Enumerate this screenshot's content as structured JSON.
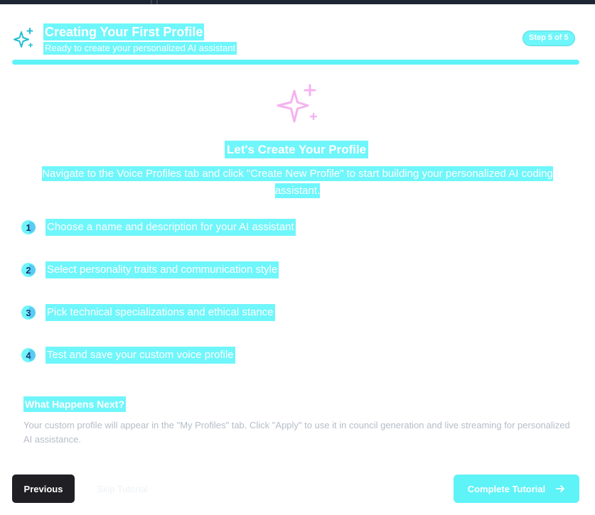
{
  "header": {
    "title": "Creating Your First Profile",
    "subtitle": "Ready to create your personalized AI assistant",
    "step_badge": "Step 5 of 5",
    "progress": 1.0,
    "icon": "sparkles-icon"
  },
  "content": {
    "hero_icon": "sparkles-icon",
    "heading": "Let's Create Your Profile",
    "description_line1": "Navigate to the Voice Profiles tab and click \"Create New Profile\" to start building your personalized AI coding",
    "description_line2": "assistant.",
    "steps": [
      {
        "number": "1",
        "text": "Choose a name and description for your AI assistant"
      },
      {
        "number": "2",
        "text": "Select personality traits and communication style"
      },
      {
        "number": "3",
        "text": "Pick technical specializations and ethical stance"
      },
      {
        "number": "4",
        "text": "Test and save your custom voice profile"
      }
    ],
    "next_title": "What Happens Next?",
    "next_body": "Your custom profile will appear in the \"My Profiles\" tab. Click \"Apply\" to use it in council generation and live streaming for personalized AI assistance."
  },
  "footer": {
    "previous_label": "Previous",
    "skip_label": "Skip Tutorial",
    "complete_label": "Complete Tutorial",
    "complete_icon": "arrow-right-icon"
  },
  "colors": {
    "highlight": "#6ff6fb",
    "accent": "#5df3f7",
    "hero_icon": "#f4b3ef",
    "header_icon": "#22bfd0",
    "dark_button": "#1f1f24"
  }
}
